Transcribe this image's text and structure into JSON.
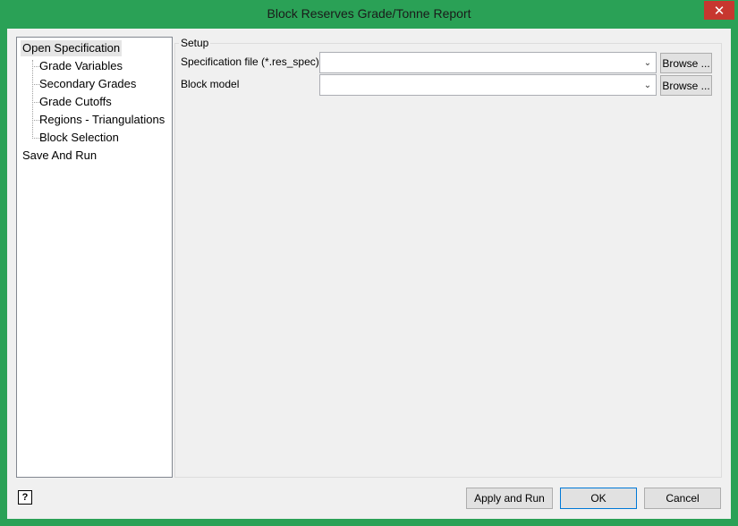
{
  "window": {
    "title": "Block Reserves Grade/Tonne Report",
    "close_glyph": "✕"
  },
  "tree": {
    "items": [
      {
        "label": "Open Specification",
        "selected": true
      },
      {
        "label": "Grade Variables"
      },
      {
        "label": "Secondary Grades"
      },
      {
        "label": "Grade Cutoffs"
      },
      {
        "label": "Regions - Triangulations"
      },
      {
        "label": "Block Selection"
      },
      {
        "label": "Save And Run"
      }
    ]
  },
  "setup": {
    "legend": "Setup",
    "spec_file_label": "Specification file (*.res_spec)",
    "spec_file_value": "",
    "block_model_label": "Block model",
    "block_model_value": "",
    "browse_label": "Browse ...",
    "dropdown_glyph": "⌄"
  },
  "footer": {
    "help_glyph": "?",
    "apply_run_label": "Apply and Run",
    "ok_label": "OK",
    "cancel_label": "Cancel"
  },
  "colors": {
    "window_frame": "#2aa156",
    "close_button": "#c7372f",
    "client_bg": "#f0f0f0"
  }
}
